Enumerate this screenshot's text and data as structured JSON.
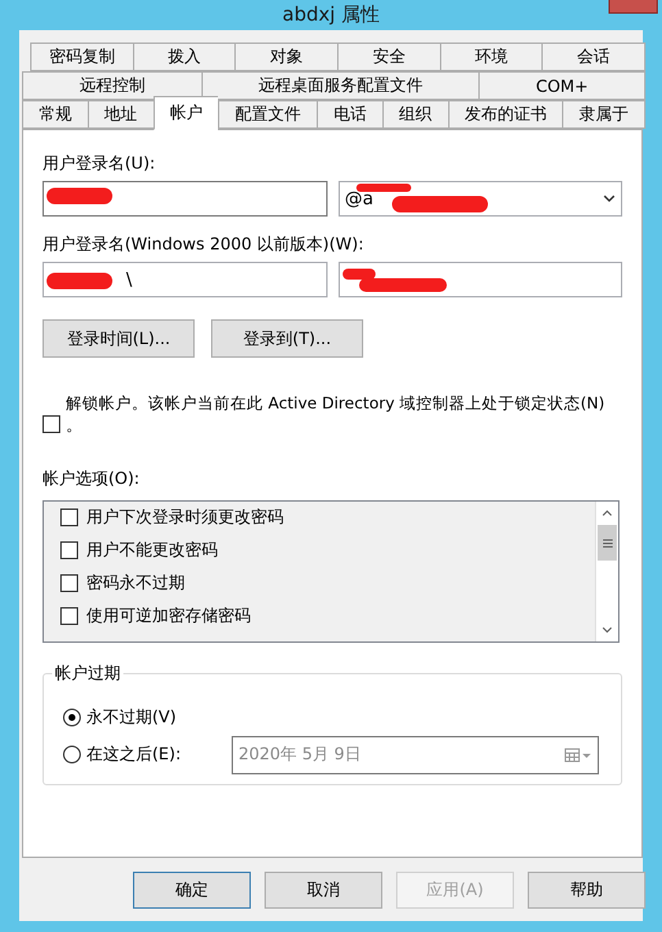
{
  "window": {
    "title": "abdxj 属性"
  },
  "tab_rows": [
    [
      {
        "label": "密码复制",
        "selected": false
      },
      {
        "label": "拨入",
        "selected": false
      },
      {
        "label": "对象",
        "selected": false
      },
      {
        "label": "安全",
        "selected": false
      },
      {
        "label": "环境",
        "selected": false
      },
      {
        "label": "会话",
        "selected": false
      }
    ],
    [
      {
        "label": "远程控制",
        "selected": false
      },
      {
        "label": "远程桌面服务配置文件",
        "selected": false
      },
      {
        "label": "COM+",
        "selected": false
      }
    ],
    [
      {
        "label": "常规",
        "selected": false
      },
      {
        "label": "地址",
        "selected": false
      },
      {
        "label": "帐户",
        "selected": true
      },
      {
        "label": "配置文件",
        "selected": false
      },
      {
        "label": "电话",
        "selected": false
      },
      {
        "label": "组织",
        "selected": false
      },
      {
        "label": "发布的证书",
        "selected": false
      },
      {
        "label": "隶属于",
        "selected": false
      }
    ]
  ],
  "logon_name": {
    "label": "用户登录名(U):",
    "suffix": "@a"
  },
  "legacy_logon_name": {
    "label": "用户登录名(Windows 2000 以前版本)(W):",
    "domain": "\\"
  },
  "buttons": [
    {
      "label": "登录时间(L)..."
    },
    {
      "label": "登录到(T)..."
    }
  ],
  "unlock": {
    "label": "解锁帐户。该帐户当前在此 Active Directory 域控制器上处于锁定状态(N)",
    "tail": "。",
    "checked": false
  },
  "account_options": {
    "label": "帐户选项(O):",
    "items": [
      {
        "label": "用户下次登录时须更改密码",
        "checked": false
      },
      {
        "label": "用户不能更改密码",
        "checked": false
      },
      {
        "label": "密码永不过期",
        "checked": false
      },
      {
        "label": "使用可逆加密存储密码",
        "checked": false
      }
    ]
  },
  "expiry": {
    "title": "帐户过期",
    "options": [
      {
        "label": "永不过期(V)",
        "selected": true
      },
      {
        "label": "在这之后(E):",
        "selected": false
      }
    ],
    "date": "2020年  5月  9日",
    "date_disabled": true
  },
  "dialog_buttons": [
    {
      "label": "确定",
      "disabled": false,
      "default": true
    },
    {
      "label": "取消",
      "disabled": false,
      "default": false
    },
    {
      "label": "应用(A)",
      "disabled": true,
      "default": false
    },
    {
      "label": "帮助",
      "disabled": false,
      "default": false
    }
  ]
}
